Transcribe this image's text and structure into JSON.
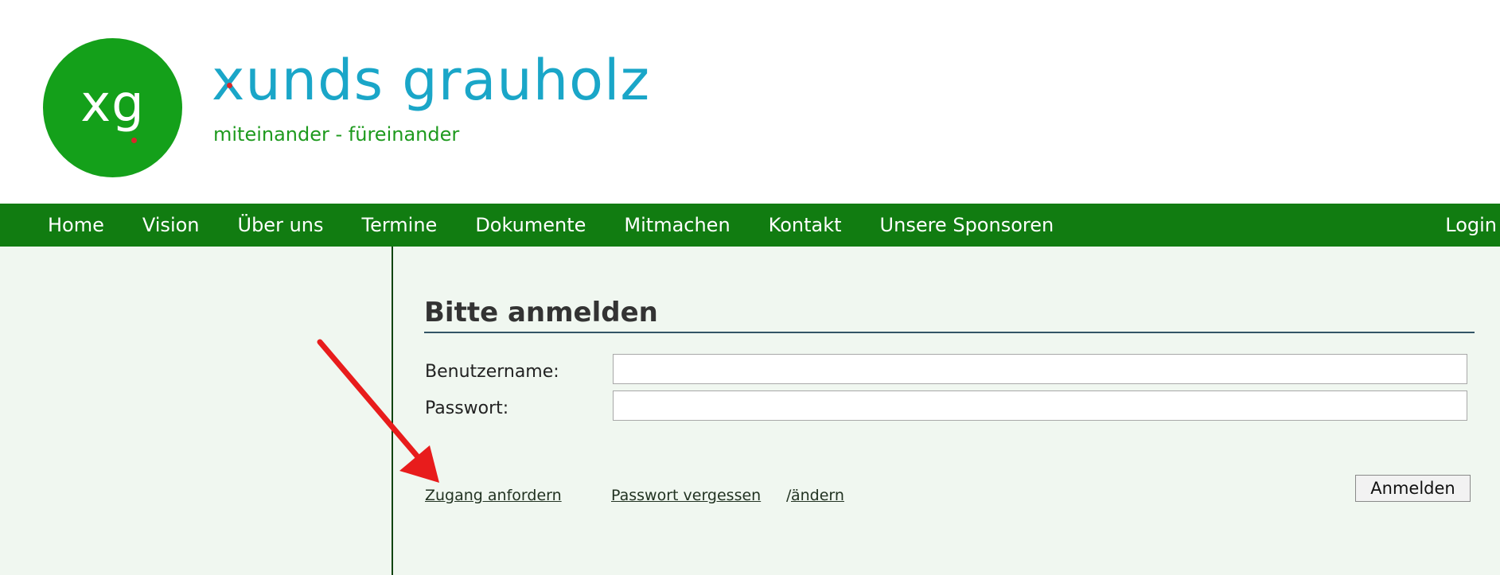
{
  "brand": {
    "logo_initials": "xg",
    "title": "xunds grauholz",
    "subtitle": "miteinander - füreinander"
  },
  "nav": {
    "items": [
      {
        "label": "Home"
      },
      {
        "label": "Vision"
      },
      {
        "label": "Über uns"
      },
      {
        "label": "Termine"
      },
      {
        "label": "Dokumente"
      },
      {
        "label": "Mitmachen"
      },
      {
        "label": "Kontakt"
      },
      {
        "label": "Unsere Sponsoren"
      }
    ],
    "login": "Login"
  },
  "form": {
    "title": "Bitte anmelden",
    "username_label": "Benutzername:",
    "username_value": "",
    "password_label": "Passwort:",
    "password_value": "",
    "request_access_link": "Zugang anfordern",
    "forgot_password_link": "Passwort vergessen",
    "separator": "/",
    "change_link": " ändern",
    "submit_label": "Anmelden"
  },
  "colors": {
    "brand_green": "#14a01a",
    "nav_green": "#117c11",
    "brand_blue": "#1aa6c8",
    "content_bg": "#f0f7f0",
    "arrow_red": "#e81c1c"
  },
  "annotations": {
    "arrow_icon": "red-arrow-icon"
  }
}
